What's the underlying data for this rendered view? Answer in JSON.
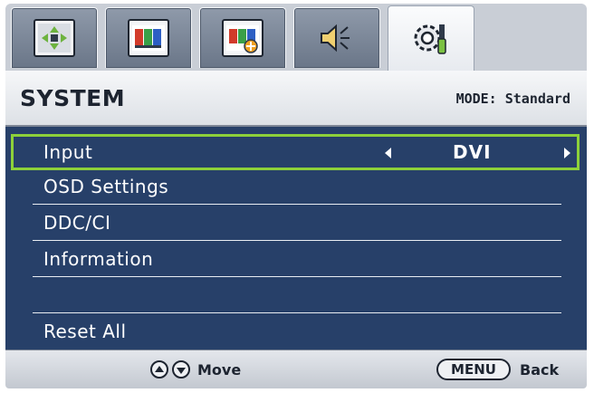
{
  "tabs": [
    {
      "icon": "picture-icon",
      "active": false
    },
    {
      "icon": "color-bars-icon",
      "active": false
    },
    {
      "icon": "picture-advanced-icon",
      "active": false
    },
    {
      "icon": "speaker-icon",
      "active": false
    },
    {
      "icon": "system-gear-icon",
      "active": true
    }
  ],
  "header": {
    "title": "SYSTEM",
    "mode": "MODE: Standard"
  },
  "menu": {
    "items": [
      {
        "label": "Input",
        "value": "DVI",
        "selected": true
      },
      {
        "label": "OSD Settings"
      },
      {
        "label": "DDC/CI"
      },
      {
        "label": "Information"
      },
      {
        "label": ""
      },
      {
        "label": "Reset All"
      }
    ]
  },
  "footer": {
    "move_label": "Move",
    "menu_key": "MENU",
    "back_label": "Back"
  },
  "colors": {
    "menu_background": "#274069",
    "selection_border": "#8dd13a",
    "header_text": "#1d2430"
  }
}
